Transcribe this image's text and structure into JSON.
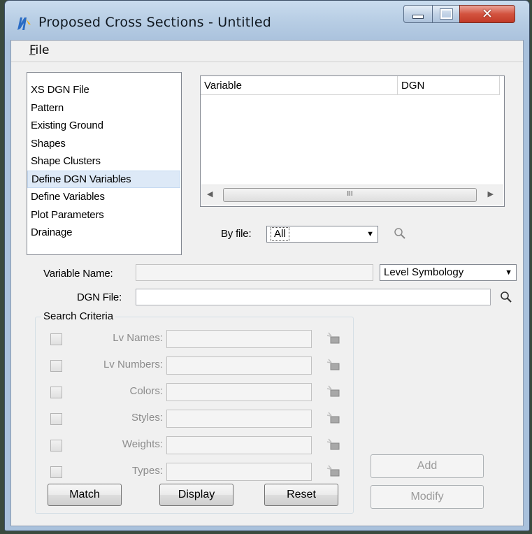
{
  "window": {
    "title": "Proposed Cross Sections - Untitled"
  },
  "menu": {
    "file_hotkey": "F",
    "file_rest": "ile"
  },
  "sections": [
    "XS DGN File",
    "Pattern",
    "Existing Ground",
    "Shapes",
    "Shape Clusters",
    "Define DGN Variables",
    "Define Variables",
    "Plot Parameters",
    "Drainage"
  ],
  "selected_section": "Define DGN Variables",
  "table": {
    "columns": [
      "Variable",
      "DGN"
    ],
    "scroll_thumb": "III"
  },
  "by_file": {
    "label": "By file:",
    "value": "All"
  },
  "variable_name": {
    "label": "Variable Name:",
    "value": ""
  },
  "level_symbology": {
    "value": "Level Symbology"
  },
  "dgn_file": {
    "label": "DGN File:",
    "value": ""
  },
  "search_criteria": {
    "title": "Search Criteria",
    "rows": [
      {
        "label": "Lv Names:",
        "checked": false,
        "value": ""
      },
      {
        "label": "Lv Numbers:",
        "checked": false,
        "value": ""
      },
      {
        "label": "Colors:",
        "checked": false,
        "value": ""
      },
      {
        "label": "Styles:",
        "checked": false,
        "value": ""
      },
      {
        "label": "Weights:",
        "checked": false,
        "value": ""
      },
      {
        "label": "Types:",
        "checked": false,
        "value": ""
      }
    ]
  },
  "buttons": {
    "match": "Match",
    "display": "Display",
    "reset": "Reset",
    "add": "Add",
    "modify": "Modify"
  },
  "colors": {
    "title_bar": "#b7cde4",
    "close_button": "#c23a28",
    "selection": "#dde9f7",
    "disabled_text": "#8a8a8a"
  }
}
